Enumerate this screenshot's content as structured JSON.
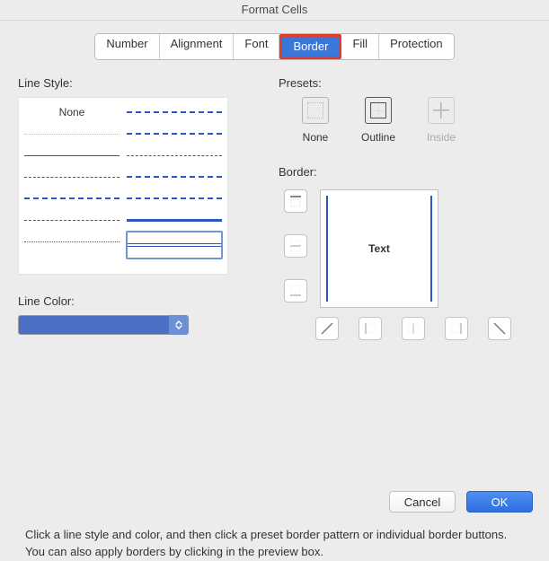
{
  "title": "Format Cells",
  "tabs": [
    "Number",
    "Alignment",
    "Font",
    "Border",
    "Fill",
    "Protection"
  ],
  "active_tab": "Border",
  "left": {
    "line_style_label": "Line Style:",
    "none_label": "None",
    "selected_style": "double",
    "line_color_label": "Line Color:",
    "line_color": "#4a6fc4"
  },
  "right": {
    "presets_label": "Presets:",
    "presets": [
      "None",
      "Outline",
      "Inside"
    ],
    "preset_selected": "Outline",
    "preset_inside_enabled": false,
    "border_label": "Border:",
    "preview_text": "Text",
    "preview_edges": {
      "left": true,
      "right": true,
      "top": false,
      "bottom": false
    }
  },
  "help": "Click a line style and color, and then click a preset border pattern or individual border buttons. You can also apply borders by clicking in the preview box.",
  "buttons": {
    "cancel": "Cancel",
    "ok": "OK"
  }
}
